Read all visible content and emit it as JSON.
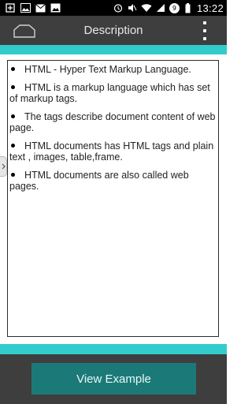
{
  "status_bar": {
    "time": "13:22",
    "badge": "9",
    "left_icons": [
      "notification-icon",
      "image-icon",
      "mail-icon",
      "photo-icon"
    ],
    "right_icons": [
      "alarm-icon",
      "mute-icon",
      "wifi-icon",
      "signal-icon",
      "battery-icon"
    ]
  },
  "action_bar": {
    "title": "Description"
  },
  "content": {
    "items": [
      "HTML - Hyper Text Markup Language.",
      "HTML is a markup language which has set of markup tags.",
      "The tags describe document content of web page.",
      "HTML documents has HTML tags and plain text , images, table,frame.",
      "HTML documents are also called web pages."
    ]
  },
  "footer": {
    "button_label": "View Example"
  },
  "colors": {
    "accent": "#33cccc",
    "bar": "#3e3e3e",
    "button": "#1b7a78"
  }
}
